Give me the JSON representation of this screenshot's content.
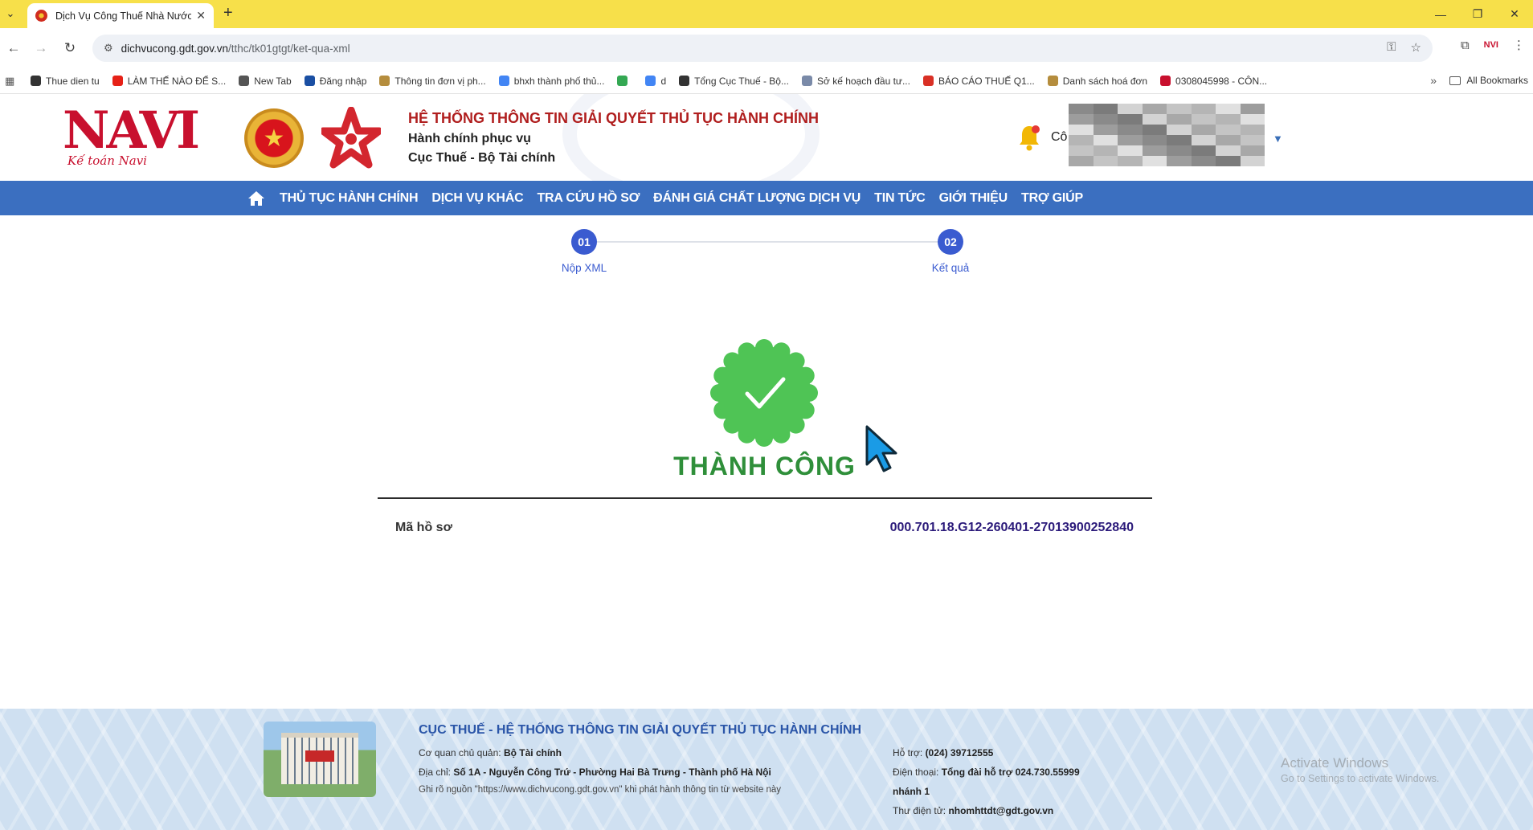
{
  "browser": {
    "tab_title": "Dịch Vụ Công Thuế Nhà Nước",
    "url_host": "dichvucong.gdt.gov.vn",
    "url_path": "/tthc/tk01gtgt/ket-qua-xml",
    "bookmarks": [
      {
        "label": "Thue dien tu",
        "color": "#333333"
      },
      {
        "label": "LÀM THẾ NÀO ĐỂ S...",
        "color": "#e62117"
      },
      {
        "label": "New Tab",
        "color": "#555555"
      },
      {
        "label": "Đăng nhập",
        "color": "#1a4fa3"
      },
      {
        "label": "Thông tin đơn vị ph...",
        "color": "#b58d3d"
      },
      {
        "label": "bhxh thành phố thủ...",
        "color": "#4285f4"
      },
      {
        "label": "",
        "color": "#34a853"
      },
      {
        "label": "d",
        "color": "#4285f4"
      },
      {
        "label": "Tổng Cục Thuế - Bộ...",
        "color": "#333333"
      },
      {
        "label": "Sở kế hoạch đầu tư...",
        "color": "#7a8aa8"
      },
      {
        "label": "BÁO CÁO THUẾ Q1...",
        "color": "#d93025"
      },
      {
        "label": "Danh sách hoá đơn",
        "color": "#b58d3d"
      },
      {
        "label": "0308045998 - CÔN...",
        "color": "#c8102e"
      }
    ],
    "all_bookmarks": "All Bookmarks"
  },
  "header": {
    "logo_letters": "NAVI",
    "logo_sub": "Kế toán Navi",
    "title": "HỆ THỐNG THÔNG TIN GIẢI QUYẾT THỦ TỤC HÀNH CHÍNH",
    "subtitle1": "Hành chính phục vụ",
    "subtitle2": "Cục Thuế - Bộ Tài chính",
    "user_label": "Cô"
  },
  "nav": {
    "items": [
      "THỦ TỤC HÀNH CHÍNH",
      "DỊCH VỤ KHÁC",
      "TRA CỨU HỒ SƠ",
      "ĐÁNH GIÁ CHẤT LƯỢNG DỊCH VỤ",
      "TIN TỨC",
      "GIỚI THIỆU",
      "TRỢ GIÚP"
    ]
  },
  "steps": [
    {
      "number": "01",
      "label": "Nộp XML"
    },
    {
      "number": "02",
      "label": "Kết quả"
    }
  ],
  "result": {
    "status": "THÀNH CÔNG",
    "record_label": "Mã hồ sơ",
    "record_value": "000.701.18.G12-260401-27013900252840"
  },
  "footer": {
    "title": "CỤC THUẾ - HỆ THỐNG THÔNG TIN GIẢI QUYẾT THỦ TỤC HÀNH CHÍNH",
    "agency_label": "Cơ quan chủ quản:",
    "agency_value": "Bộ Tài chính",
    "address_label": "Địa chỉ:",
    "address_value": "Số 1A - Nguyễn Công Trứ - Phường Hai Bà Trưng - Thành phố Hà Nội",
    "source_note": "Ghi rõ nguồn \"https://www.dichvucong.gdt.gov.vn\" khi phát hành thông tin từ website này",
    "support_label": "Hỗ trợ:",
    "support_value": "(024) 39712555",
    "phone_label": "Điện thoại:",
    "phone_value": "Tổng đài hỗ trợ 024.730.55999",
    "phone_ext": "nhánh 1",
    "email_label": "Thư điện tử:",
    "email_value": "nhomhttdt@gdt.gov.vn"
  },
  "watermark": {
    "line1": "Activate Windows",
    "line2": "Go to Settings to activate Windows."
  }
}
